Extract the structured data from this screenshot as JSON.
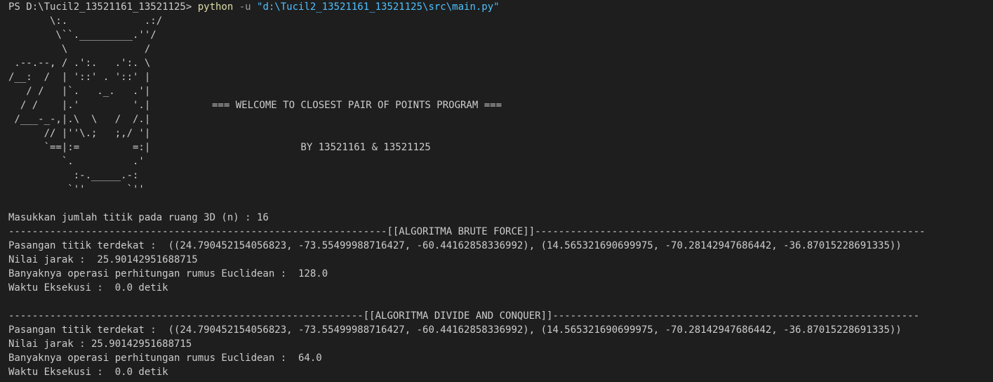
{
  "command_line": {
    "prompt": "PS D:\\Tucil2_13521161_13521125> ",
    "command": "python",
    "flag": " -u ",
    "path": "\"d:\\Tucil2_13521161_13521125\\src\\main.py\""
  },
  "ascii_art": "       \\:.             .:/\n        \\``._________.''/\n         \\             /\n .--.--, / .':.   .':. \\\n/__:  /  | '::' . '::' |\n   / /   |`.   ._.   .'|\n  / /    |.'         '.|\n /___-_-,|.\\  \\   /  /.|\n      // |''\\.;   ;,/ '|\n      `==|:=         =:|\n         `.          .'\n           :-._____.-:\n          `''       `''",
  "welcome": {
    "title": "=== WELCOME TO CLOSEST PAIR OF POINTS PROGRAM ===",
    "byline": "               BY 13521161 & 13521125"
  },
  "input_prompt": "Masukkan jumlah titik pada ruang 3D (n) : 16",
  "brute_force": {
    "separator": "----------------------------------------------------------------[[ALGORITMA BRUTE FORCE]]------------------------------------------------------------------",
    "pair": "Pasangan titik terdekat :  ((24.790452154056823, -73.55499988716427, -60.44162858336992), (14.565321690699975, -70.28142947686442, -36.87015228691335))",
    "distance": "Nilai jarak :  25.90142951688715",
    "operations": "Banyaknya operasi perhitungan rumus Euclidean :  128.0",
    "time": "Waktu Eksekusi :  0.0 detik"
  },
  "divide_conquer": {
    "separator": "------------------------------------------------------------[[ALGORITMA DIVIDE AND CONQUER]]--------------------------------------------------------------",
    "pair": "Pasangan titik terdekat :  ((24.790452154056823, -73.55499988716427, -60.44162858336992), (14.565321690699975, -70.28142947686442, -36.87015228691335))",
    "distance": "Nilai jarak : 25.90142951688715",
    "operations": "Banyaknya operasi perhitungan rumus Euclidean :  64.0",
    "time": "Waktu Eksekusi :  0.0 detik"
  }
}
